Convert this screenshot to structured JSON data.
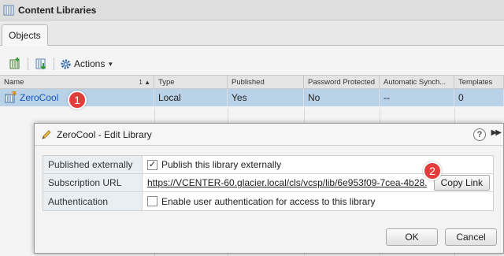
{
  "window": {
    "title": "Content Libraries",
    "icon": "content-library-icon"
  },
  "tabs": [
    {
      "label": "Objects",
      "active": true
    }
  ],
  "toolbar": {
    "new_icon": "new-library-icon",
    "import_icon": "import-icon",
    "actions_label": "Actions",
    "actions_icon": "gear-icon"
  },
  "table": {
    "columns": [
      {
        "label": "Name",
        "sort": "1 ▲"
      },
      {
        "label": "Type"
      },
      {
        "label": "Published"
      },
      {
        "label": "Password Protected"
      },
      {
        "label": "Automatic Synch..."
      },
      {
        "label": "Templates"
      }
    ],
    "rows": [
      {
        "name": "ZeroCool",
        "type": "Local",
        "published": "Yes",
        "password_protected": "No",
        "automatic_sync": "--",
        "templates": "0",
        "selected": true
      }
    ]
  },
  "callouts": [
    {
      "number": "1",
      "color": "#e23c3c"
    },
    {
      "number": "2",
      "color": "#e23c3c"
    }
  ],
  "dialog": {
    "title": "ZeroCool - Edit Library",
    "help_label": "?",
    "expand_label": "▶▶",
    "fields": {
      "published_externally": {
        "label": "Published externally",
        "checkbox_checked": true,
        "checkbox_label": "Publish this library externally"
      },
      "subscription_url": {
        "label": "Subscription URL",
        "value": "https://VCENTER-60.glacier.local/cls/vcsp/lib/6e953f09-7cea-4b28...",
        "copy_button": "Copy Link"
      },
      "authentication": {
        "label": "Authentication",
        "checkbox_checked": false,
        "checkbox_label": "Enable user authentication for access to this library"
      }
    },
    "buttons": {
      "ok": "OK",
      "cancel": "Cancel"
    }
  },
  "colors": {
    "selection": "#b9d2e8",
    "link": "#1659b8",
    "callout": "#e23c3c"
  }
}
